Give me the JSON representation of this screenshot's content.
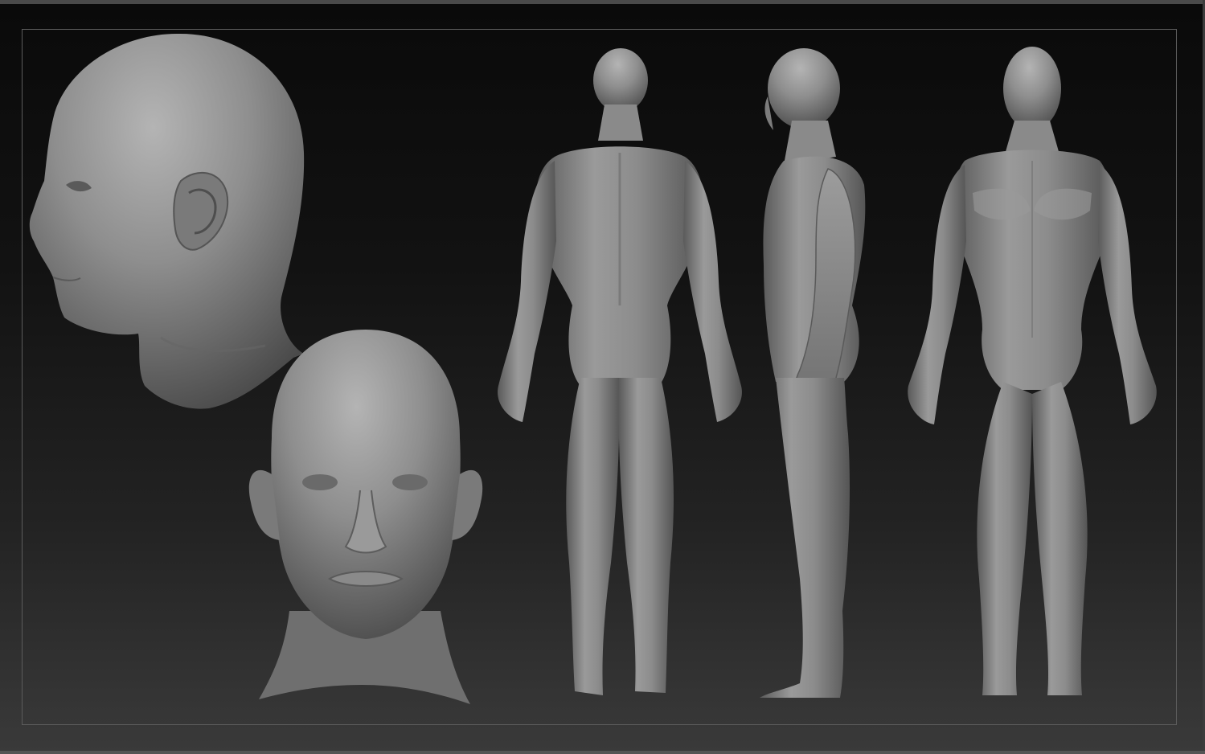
{
  "viewport": {
    "background_top": "#0a0a0a",
    "background_bottom": "#3a3a3a",
    "frame_color": "#5c5c5c",
    "clay_color": "#8a8a8a"
  },
  "views": [
    {
      "name": "head-side-view"
    },
    {
      "name": "head-front-view"
    },
    {
      "name": "body-back-view"
    },
    {
      "name": "body-side-view"
    },
    {
      "name": "body-front-view"
    }
  ]
}
